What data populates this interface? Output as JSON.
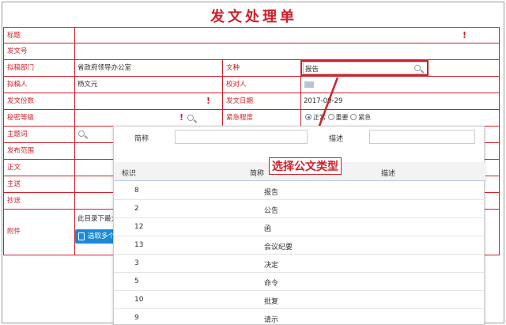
{
  "form": {
    "title": "发文处理单",
    "labels": {
      "title": "标题",
      "doc_no": "发文号",
      "dept": "拟稿部门",
      "doc_type": "文种",
      "drafter": "拟稿人",
      "proofreader": "校对人",
      "copies": "发文份数",
      "date": "发文日期",
      "secret": "秘密等级",
      "urgency": "紧急程度",
      "keywords": "主题词",
      "scope": "发布范围",
      "body": "正文",
      "main_send": "主送",
      "cc": "抄送",
      "attach": "附件"
    },
    "values": {
      "dept": "省政府领导办公室",
      "doc_type": "报告",
      "drafter": "杨文元",
      "date": "2017-09-29",
      "attach_note": "此目录下最大",
      "attach_btn": "选取多个"
    },
    "urgency_options": [
      "正常",
      "重要",
      "紧急"
    ],
    "urgency_selected": "正常",
    "required_mark": "!"
  },
  "popup": {
    "search_short_label": "简称",
    "search_desc_label": "描述",
    "columns": [
      "标识",
      "简称",
      "描述"
    ],
    "rows": [
      {
        "id": "8",
        "name": "报告"
      },
      {
        "id": "2",
        "name": "公告"
      },
      {
        "id": "12",
        "name": "函"
      },
      {
        "id": "13",
        "name": "会议纪要"
      },
      {
        "id": "3",
        "name": "决定"
      },
      {
        "id": "5",
        "name": "命令"
      },
      {
        "id": "10",
        "name": "批复"
      },
      {
        "id": "9",
        "name": "请示"
      }
    ]
  },
  "annotation": {
    "callout": "选择公文类型",
    "color": "#d0202a"
  },
  "colors": {
    "accent": "#d0202a",
    "button": "#1a8ad8"
  }
}
